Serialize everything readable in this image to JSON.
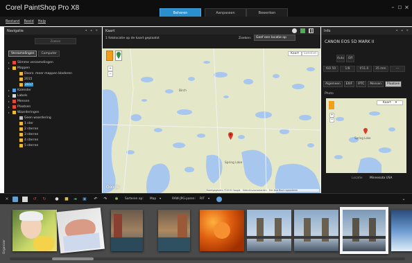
{
  "app": {
    "title": "Corel PaintShop Pro X8",
    "tabs": [
      {
        "label": "Beheren",
        "active": true
      },
      {
        "label": "Aanpassen",
        "active": false
      },
      {
        "label": "Bewerken",
        "active": false
      }
    ],
    "window_controls": [
      "–",
      "□",
      "×"
    ]
  },
  "menu": [
    "Bestand",
    "Beeld",
    "Help"
  ],
  "navigation": {
    "title": "Navigatie",
    "search_placeholder": "Zoeken",
    "tabs": [
      {
        "label": "Verzamelingen",
        "active": true
      },
      {
        "label": "Computer",
        "active": false
      }
    ],
    "tree": [
      {
        "label": "Slimme verzamelingen",
        "level": 0,
        "color": "#e04a3a"
      },
      {
        "label": "Mappen",
        "level": 0,
        "color": "#e8b838"
      },
      {
        "label": "Doorz. meer mappen bladeren",
        "level": 1,
        "color": "#e8b838"
      },
      {
        "label": "2015",
        "level": 1,
        "color": "#e8b838"
      },
      {
        "label": "2017",
        "level": 1,
        "color": "#e8b838",
        "selected": true
      },
      {
        "label": "Kalender",
        "level": 0,
        "color": "#5aa0e0"
      },
      {
        "label": "Labels",
        "level": 0,
        "color": "#d8d8d8"
      },
      {
        "label": "Mensen",
        "level": 0,
        "color": "#e04a3a"
      },
      {
        "label": "Plaatsen",
        "level": 0,
        "color": "#e04a3a"
      },
      {
        "label": "Waarderingen",
        "level": 0,
        "color": "#e8b838"
      },
      {
        "label": "Geen waardering",
        "level": 1,
        "color": "#bbbbbb"
      },
      {
        "label": "1 ster",
        "level": 1,
        "color": "#e8b838"
      },
      {
        "label": "2 sterren",
        "level": 1,
        "color": "#e8b838"
      },
      {
        "label": "3 sterren",
        "level": 1,
        "color": "#e8b838"
      },
      {
        "label": "4 sterren",
        "level": 1,
        "color": "#e8b838"
      },
      {
        "label": "5 sterren",
        "level": 1,
        "color": "#e8b838"
      }
    ]
  },
  "map": {
    "title": "Kaart",
    "status": "1 fotolocatie op de kaart geplaatst",
    "search_label": "Zoeken:",
    "search_value": "Geef een locatie op",
    "map_type_buttons": [
      "Kaart",
      "Satelliet"
    ],
    "zoom_in": "+",
    "zoom_out": "−",
    "place_labels": [
      "Birch",
      "Spring Lake"
    ],
    "attribution": "Kaartgegevens ©2015 Google · Gebruiksvoorwaarden · Een kaartfout rapporteren",
    "google_logo": "Google"
  },
  "info": {
    "title": "Info",
    "camera": "CANON EOS 5D MARK II",
    "exif": [
      "ISO 50",
      "1/8",
      "f/11.0",
      "35 mm",
      "---"
    ],
    "mode_buttons": [
      "Auto",
      "Off"
    ],
    "tabs": [
      {
        "label": "Algemeen",
        "active": false
      },
      {
        "label": "EXIF",
        "active": false
      },
      {
        "label": "IPTC",
        "active": false
      },
      {
        "label": "Mensen",
        "active": false
      },
      {
        "label": "Plaatsen",
        "active": true
      }
    ],
    "photo_label": "Photo",
    "minimap_type": "Kaart",
    "location_label": "Locatie",
    "location_value": "Minnesota USA"
  },
  "toolbar": {
    "sort_label": "Sorteren op:",
    "sort_value": "Map",
    "raw_label": "RAW-JPG-paren:",
    "raw_value": "RIT"
  },
  "filmstrip": {
    "label": "Organizer",
    "thumbs": [
      {
        "name": "thumb-girl-flowers"
      },
      {
        "name": "thumb-baby"
      },
      {
        "name": "thumb-canal-1"
      },
      {
        "name": "thumb-canal-2"
      },
      {
        "name": "thumb-roses"
      },
      {
        "name": "thumb-bridge-1"
      },
      {
        "name": "thumb-bridge-2"
      },
      {
        "name": "thumb-bridge-3",
        "selected": true
      },
      {
        "name": "thumb-wave"
      }
    ]
  },
  "colors": {
    "accent": "#2a8fcc",
    "map_land": "#e4e8c8",
    "map_water": "#a8c7ee",
    "pin": "#d93b2b"
  }
}
